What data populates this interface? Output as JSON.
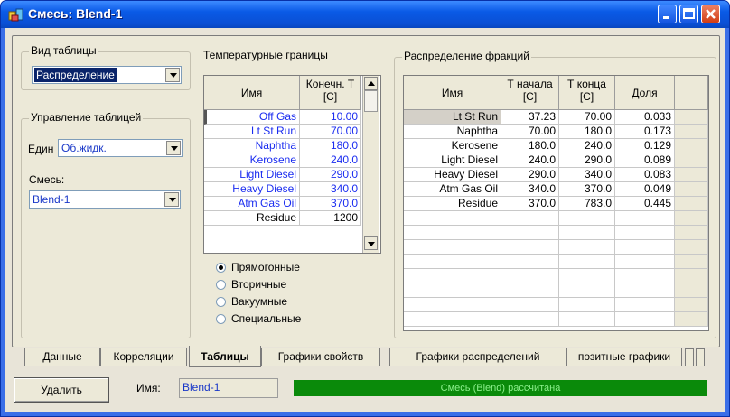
{
  "window": {
    "title": "Смесь: Blend-1",
    "accent": "#0a5ae6"
  },
  "view_group": {
    "title": "Вид таблицы",
    "selected": "Распределение"
  },
  "control_group": {
    "title": "Управление таблицей",
    "units_label": "Един",
    "units_value": "Об.жидк.",
    "blend_label": "Смесь:",
    "blend_value": "Blend-1"
  },
  "temp_group": {
    "title": "Температурные границы",
    "headers": [
      "Имя",
      "Конечн. Т",
      "[C]"
    ],
    "rows": [
      {
        "name": "Off Gas",
        "value": "10.00"
      },
      {
        "name": "Lt St Run",
        "value": "70.00"
      },
      {
        "name": "Naphtha",
        "value": "180.0"
      },
      {
        "name": "Kerosene",
        "value": "240.0"
      },
      {
        "name": "Light Diesel",
        "value": "290.0"
      },
      {
        "name": "Heavy Diesel",
        "value": "340.0"
      },
      {
        "name": "Atm Gas Oil",
        "value": "370.0"
      },
      {
        "name": "Residue",
        "value": "1200"
      }
    ],
    "radios": [
      {
        "label": "Прямогонные",
        "checked": true
      },
      {
        "label": "Вторичные",
        "checked": false
      },
      {
        "label": "Вакуумные",
        "checked": false
      },
      {
        "label": "Специальные",
        "checked": false
      }
    ]
  },
  "dist_group": {
    "title": "Распределение фракций",
    "headers": {
      "name": "Имя",
      "t_start": "Т начала",
      "t_start_unit": "[C]",
      "t_end": "Т конца",
      "t_end_unit": "[C]",
      "share": "Доля"
    },
    "rows": [
      {
        "name": "Lt St Run",
        "t_start": "37.23",
        "t_end": "70.00",
        "share": "0.033"
      },
      {
        "name": "Naphtha",
        "t_start": "70.00",
        "t_end": "180.0",
        "share": "0.173"
      },
      {
        "name": "Kerosene",
        "t_start": "180.0",
        "t_end": "240.0",
        "share": "0.129"
      },
      {
        "name": "Light Diesel",
        "t_start": "240.0",
        "t_end": "290.0",
        "share": "0.089"
      },
      {
        "name": "Heavy Diesel",
        "t_start": "290.0",
        "t_end": "340.0",
        "share": "0.083"
      },
      {
        "name": "Atm Gas Oil",
        "t_start": "340.0",
        "t_end": "370.0",
        "share": "0.049"
      },
      {
        "name": "Residue",
        "t_start": "370.0",
        "t_end": "783.0",
        "share": "0.445"
      }
    ]
  },
  "tabs": [
    "Данные",
    "Корреляции",
    "Таблицы",
    "Графики свойств",
    "Графики распределений",
    "позитные графики"
  ],
  "active_tab": "Таблицы",
  "bottom": {
    "delete_label": "Удалить",
    "name_label": "Имя:",
    "name_value": "Blend-1",
    "status": "Смесь (Blend) рассчитана",
    "status_color": "#0a8a0a"
  }
}
